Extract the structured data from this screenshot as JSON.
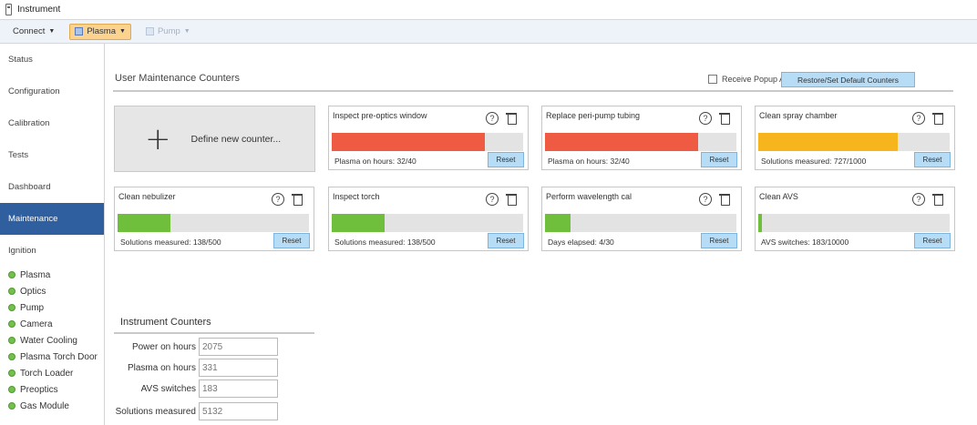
{
  "window": {
    "title": "Instrument"
  },
  "toolbar": {
    "connect": "Connect",
    "plasma": "Plasma",
    "pump": "Pump"
  },
  "sidebar": {
    "nav": [
      "Status",
      "Configuration",
      "Calibration",
      "Tests",
      "Dashboard",
      "Maintenance",
      "Ignition"
    ],
    "active": "Maintenance",
    "sub_items": [
      "Plasma",
      "Optics",
      "Pump",
      "Camera",
      "Water Cooling",
      "Plasma Torch Door",
      "Torch Loader",
      "Preoptics",
      "Gas Module"
    ]
  },
  "main": {
    "title": "User Maintenance Counters",
    "popup_alerts_label": "Receive Popup Alerts",
    "restore_button": "Restore/Set Default Counters",
    "define_new": "Define new counter...",
    "reset_label": "Reset",
    "colors": {
      "red": "#ef5a43",
      "orange": "#f6b51d",
      "green": "#6fbf3d"
    },
    "counters": [
      {
        "title": "Inspect pre-optics window",
        "status": "Plasma on hours: 32/40",
        "fraction": 0.8,
        "color": "red"
      },
      {
        "title": "Replace peri-pump tubing",
        "status": "Plasma on hours: 32/40",
        "fraction": 0.8,
        "color": "red"
      },
      {
        "title": "Clean spray chamber",
        "status": "Solutions measured: 727/1000",
        "fraction": 0.727,
        "color": "orange"
      },
      {
        "title": "Clean nebulizer",
        "status": "Solutions measured: 138/500",
        "fraction": 0.276,
        "color": "green"
      },
      {
        "title": "Inspect torch",
        "status": "Solutions measured: 138/500",
        "fraction": 0.276,
        "color": "green"
      },
      {
        "title": "Perform wavelength cal",
        "status": "Days elapsed: 4/30",
        "fraction": 0.133,
        "color": "green"
      },
      {
        "title": "Clean AVS",
        "status": "AVS switches: 183/10000",
        "fraction": 0.018,
        "color": "green"
      }
    ]
  },
  "instrument_counters": {
    "title": "Instrument Counters",
    "rows": [
      {
        "label": "Power on hours",
        "value": "2075"
      },
      {
        "label": "Plasma on hours",
        "value": "331"
      },
      {
        "label": "AVS switches",
        "value": "183"
      },
      {
        "label": "Solutions measured",
        "value": "5132"
      }
    ]
  }
}
